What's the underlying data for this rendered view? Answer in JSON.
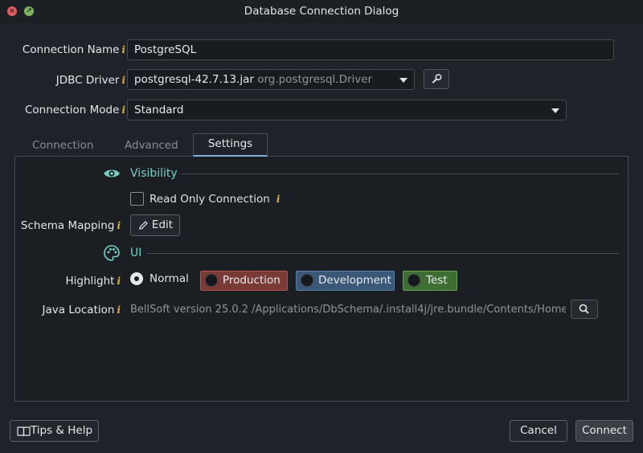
{
  "window": {
    "title": "Database Connection Dialog"
  },
  "fields": {
    "connection_name": {
      "label": "Connection Name",
      "value": "PostgreSQL"
    },
    "jdbc_driver": {
      "label": "JDBC Driver",
      "jar": "postgresql-42.7.13.jar",
      "class": "org.postgresql.Driver"
    },
    "connection_mode": {
      "label": "Connection Mode",
      "value": "Standard"
    }
  },
  "info_glyph": "i",
  "tabs": [
    {
      "label": "Connection"
    },
    {
      "label": "Advanced"
    },
    {
      "label": "Settings"
    }
  ],
  "settings": {
    "visibility": {
      "title": "Visibility",
      "read_only_label": "Read Only Connection",
      "read_only_checked": false
    },
    "schema_mapping": {
      "label": "Schema Mapping",
      "edit_label": "Edit"
    },
    "ui": {
      "title": "UI"
    },
    "highlight": {
      "label": "Highlight",
      "selected": "Normal",
      "options": [
        {
          "label": "Normal"
        },
        {
          "label": "Production",
          "color": "#7a3a36"
        },
        {
          "label": "Development",
          "color": "#3c5878"
        },
        {
          "label": "Test",
          "color": "#3f6e34"
        }
      ]
    },
    "java_location": {
      "label": "Java Location",
      "value": "BellSoft version 25.0.2 /Applications/DbSchema/.install4j/jre.bundle/Contents/Home"
    }
  },
  "footer": {
    "tips_label": "Tips & Help",
    "cancel_label": "Cancel",
    "connect_label": "Connect"
  },
  "colors": {
    "accent_teal": "#76cfc3",
    "info_yellow": "#d8b24a",
    "tab_underline": "#7eb0d8"
  }
}
